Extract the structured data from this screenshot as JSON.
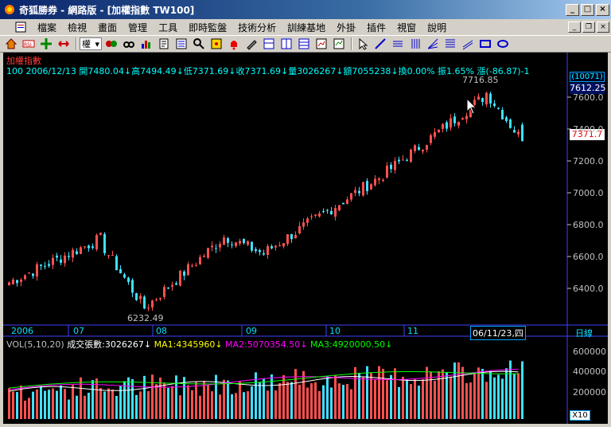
{
  "window": {
    "title": "奇狐勝券 - 網路版 - [加權指數 TW100]"
  },
  "menu": [
    "檔案",
    "檢視",
    "畫面",
    "管理",
    "工具",
    "即時監盤",
    "技術分析",
    "訓練基地",
    "外掛",
    "插件",
    "視窗",
    "說明"
  ],
  "toolbar": {
    "period_select": "權"
  },
  "chart": {
    "name": "加權指數",
    "info_line": "100 2006/12/13 開7480.04↓高7494.49↓低7371.69↓收7371.69↓量3026267↓額7055238↓換0.00% 振1.65% 漲(-86.87)-1",
    "high_label": "7716.85",
    "low_label": "6232.49",
    "last_badge": "(10071)",
    "price_badge": "7612.25",
    "close_badge": "7371.7",
    "y_ticks": [
      "7600.0",
      "7400.0",
      "7200.0",
      "7000.0",
      "6800.0",
      "6600.0",
      "6400.0"
    ],
    "x_ticks": [
      "2006",
      "07",
      "08",
      "09",
      "10",
      "11"
    ],
    "cursor_date": "06/11/23,四",
    "period_label": "日線"
  },
  "volume": {
    "header": "VOL(5,10,20)",
    "value": "成交張數:3026267↓",
    "ma1": "MA1:4345960↓",
    "ma2": "MA2:5070354.50↓",
    "ma3": "MA3:4920000.50↓",
    "y_ticks": [
      "600000",
      "400000",
      "200000"
    ],
    "scale": "X10"
  },
  "chart_data": {
    "type": "candlestick",
    "title": "加權指數",
    "ylim": [
      6232.49,
      7716.85
    ],
    "last": {
      "date": "2006/12/13",
      "open": 7480.04,
      "high": 7494.49,
      "low": 7371.69,
      "close": 7371.69,
      "volume": 3026267
    },
    "x_months": [
      "2006",
      "07",
      "08",
      "09",
      "10",
      "11"
    ],
    "y_ticks": [
      6400,
      6600,
      6800,
      7000,
      7200,
      7400,
      7600
    ],
    "volume_y_ticks": [
      200000,
      400000,
      600000
    ]
  },
  "colors": {
    "up": "#ff5050",
    "down": "#40e0ff",
    "ma1": "#ffffff",
    "ma2": "#ff00ff",
    "ma3": "#00ff00"
  }
}
